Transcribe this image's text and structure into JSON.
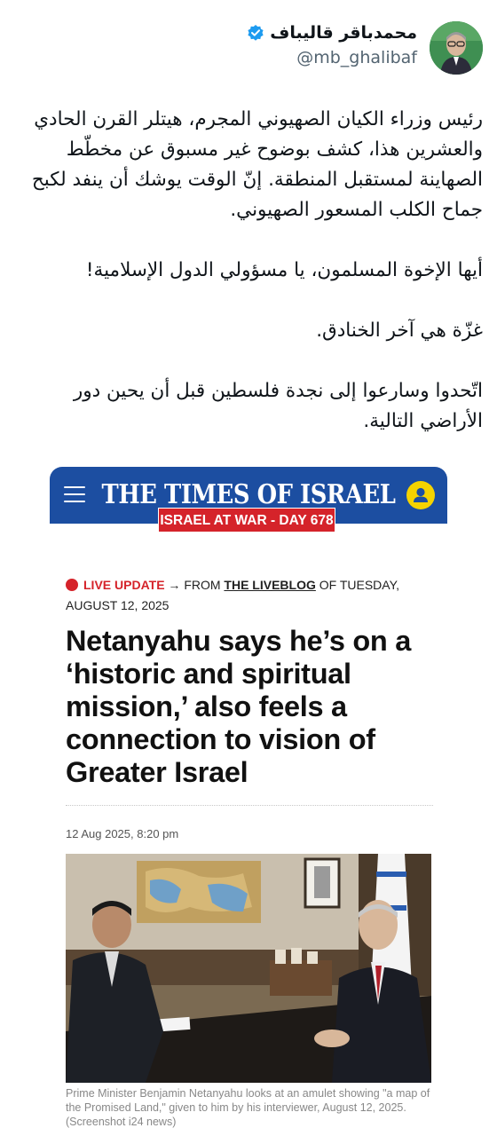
{
  "tweet": {
    "display_name": "محمدباقر قالیباف",
    "handle": "@mb_ghalibaf",
    "verified_icon": "verified-badge-icon",
    "paragraphs": [
      "رئیس وزراء الکیان الصهیوني المجرم، هیتلر القرن الحادي والعشرین هذا، کشف بوضوح غیر مسبوق عن مخطّط الصهاینة لمستقبل المنطقة. إنّ الوقت یوشك أن ینفد لکبح جماح الکلب المسعور الصهیوني.",
      "أیها الإخوة المسلمون، یا مسؤولي الدول الإسلامیة!",
      "غزّة هي آخر الخنادق.",
      "اتّحدوا وسارعوا إلى نجدة فلسطین قبل أن یحین دور الأراضي التالیة."
    ]
  },
  "article_card": {
    "site_name": "THE TIMES OF ISRAEL",
    "banner": "ISRAEL AT WAR - DAY 678",
    "menu_icon": "hamburger-menu-icon",
    "user_icon": "user-account-icon",
    "live_label": "LIVE UPDATE",
    "arrow": "→",
    "from_text": "FROM",
    "liveblog_link": "THE LIVEBLOG",
    "of_text": "OF TUESDAY, AUGUST 12, 2025",
    "headline": "Netanyahu says he’s on a ‘historic and spiritual mission,’ also feels a connection to vision of Greater Israel",
    "dateline": "12 Aug 2025, 8:20 pm",
    "caption": "Prime Minister Benjamin Netanyahu looks at an amulet showing \"a map of the Promised Land,\" given to him by his interviewer, August 12, 2025. (Screenshot i24 news)"
  },
  "colors": {
    "site_blue": "#1c4ea1",
    "banner_red": "#d5232a",
    "user_icon_yellow": "#f5d300",
    "verified_blue": "#1d9bf0",
    "handle_gray": "#536471"
  }
}
